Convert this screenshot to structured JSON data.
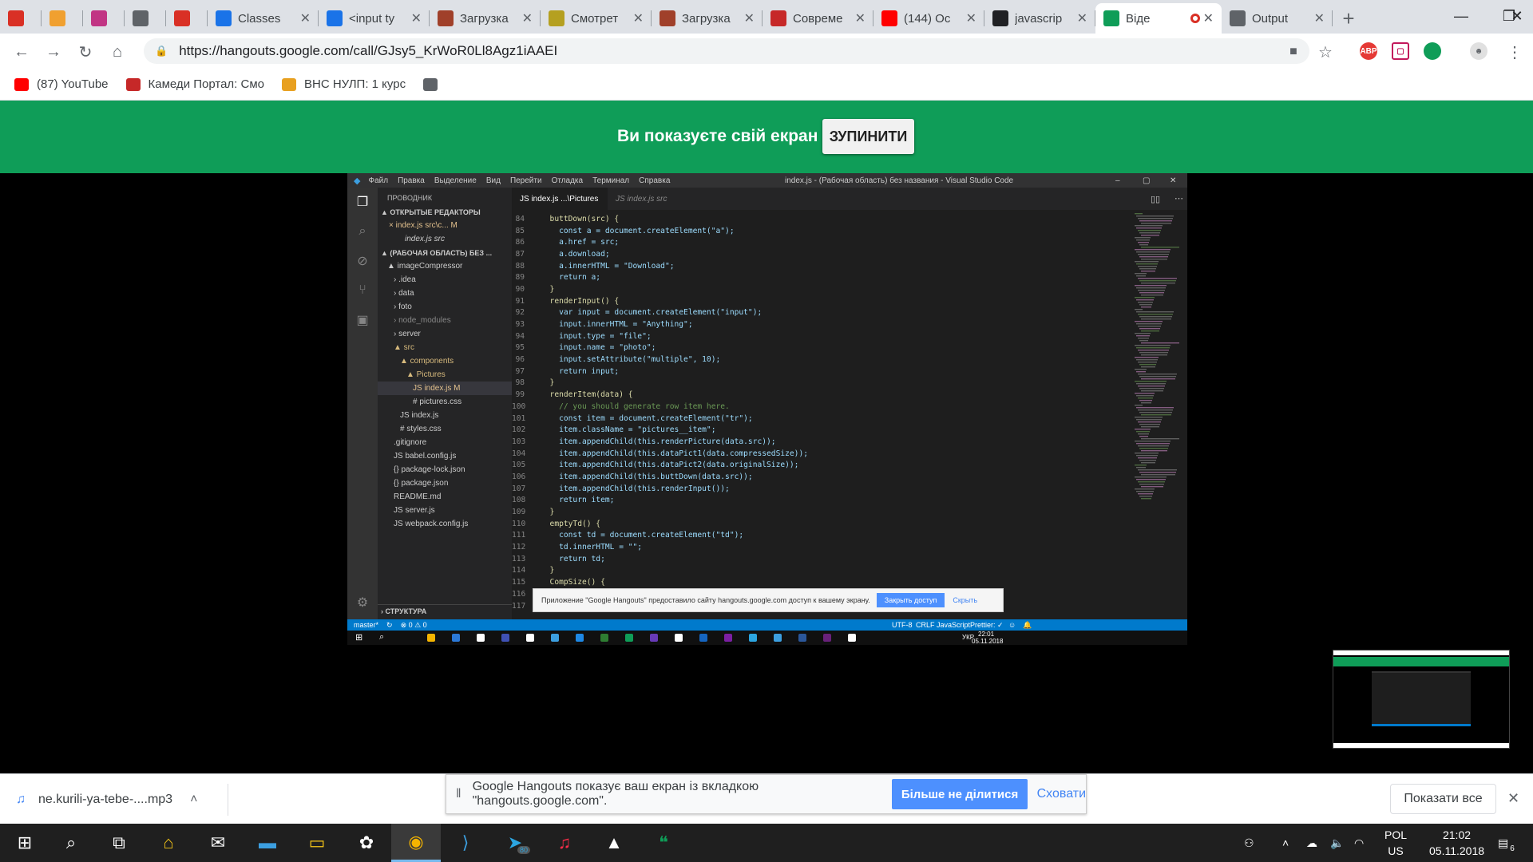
{
  "browser": {
    "tabs": [
      {
        "label": "",
        "icon": "gmail-icon",
        "color": "#d93025"
      },
      {
        "label": "",
        "icon": "moodle-icon",
        "color": "#f0a030"
      },
      {
        "label": "",
        "icon": "instagram-icon",
        "color": "#c13584"
      },
      {
        "label": "",
        "icon": "docs-icon",
        "color": "#5f6368"
      },
      {
        "label": "",
        "icon": "car-icon",
        "color": "#d93025"
      },
      {
        "label": "Classes",
        "icon": "classroom-icon",
        "color": "#1a73e8"
      },
      {
        "label": "<input ty",
        "icon": "classroom-icon",
        "color": "#1a73e8"
      },
      {
        "label": "Загрузка",
        "icon": "square-icon",
        "color": "#a0402a"
      },
      {
        "label": "Смотрет",
        "icon": "hat-icon",
        "color": "#b5a020"
      },
      {
        "label": "Загрузка",
        "icon": "square-icon",
        "color": "#a0402a"
      },
      {
        "label": "Совреме",
        "icon": "figure-icon",
        "color": "#c62828"
      },
      {
        "label": "(144) Oc",
        "icon": "youtube-icon",
        "color": "#ff0000"
      },
      {
        "label": "javascrip",
        "icon": "glasses-icon",
        "color": "#202124"
      },
      {
        "label": "Віде",
        "icon": "hangouts-icon",
        "color": "#0f9d58",
        "active": true
      },
      {
        "label": "Output",
        "icon": "page-icon",
        "color": "#5f6368"
      }
    ],
    "url": "https://hangouts.google.com/call/GJsy5_KrWoR0Ll8Agz1iAAEI",
    "bookmarks": [
      {
        "label": "(87) YouTube",
        "color": "#ff0000"
      },
      {
        "label": "Камеди Портал: Смо",
        "color": "#c62828"
      },
      {
        "label": "ВНС НУЛП: 1 курс",
        "color": "#e8a020"
      },
      {
        "label": "",
        "color": "#5f6368"
      }
    ],
    "ext_abp": "ABP"
  },
  "banner": {
    "text": "Ви показуєте свій екран",
    "stop_label": "ЗУПИНИТИ",
    "color": "#0f9d58"
  },
  "vscode": {
    "menu": [
      "Файл",
      "Правка",
      "Выделение",
      "Вид",
      "Перейти",
      "Отладка",
      "Терминал",
      "Справка"
    ],
    "title": "index.js - (Рабочая область) без названия - Visual Studio Code",
    "explorer_title": "ПРОВОДНИК",
    "open_editors": "▲ ОТКРЫТЫЕ РЕДАКТОРЫ",
    "open_files": [
      "× index.js src\\c...  M",
      "index.js src"
    ],
    "workspace": "▲ (РАБОЧАЯ ОБЛАСТЬ) БЕЗ ...",
    "tree": [
      {
        "label": "▲ imageCompressor",
        "indent": 0,
        "color": "#ccc"
      },
      {
        "label": "› .idea",
        "indent": 1,
        "color": "#ccc"
      },
      {
        "label": "› data",
        "indent": 1,
        "color": "#ccc"
      },
      {
        "label": "› foto",
        "indent": 1,
        "color": "#ccc"
      },
      {
        "label": "› node_modules",
        "indent": 1,
        "color": "#888"
      },
      {
        "label": "› server",
        "indent": 1,
        "color": "#ccc"
      },
      {
        "label": "▲ src",
        "indent": 1,
        "color": "#d7ba7d"
      },
      {
        "label": "▲ components",
        "indent": 2,
        "color": "#d7ba7d"
      },
      {
        "label": "▲ Pictures",
        "indent": 3,
        "color": "#d7ba7d"
      },
      {
        "label": "JS index.js           M",
        "indent": 4,
        "color": "#e2c08d",
        "selected": true
      },
      {
        "label": "# pictures.css",
        "indent": 4,
        "color": "#ccc"
      },
      {
        "label": "JS index.js",
        "indent": 2,
        "color": "#ccc"
      },
      {
        "label": "# styles.css",
        "indent": 2,
        "color": "#ccc"
      },
      {
        "label": ".gitignore",
        "indent": 1,
        "color": "#ccc"
      },
      {
        "label": "JS babel.config.js",
        "indent": 1,
        "color": "#ccc"
      },
      {
        "label": "{} package-lock.json",
        "indent": 1,
        "color": "#ccc"
      },
      {
        "label": "{} package.json",
        "indent": 1,
        "color": "#ccc"
      },
      {
        "label": "README.md",
        "indent": 1,
        "color": "#ccc"
      },
      {
        "label": "JS server.js",
        "indent": 1,
        "color": "#ccc"
      },
      {
        "label": "JS webpack.config.js",
        "indent": 1,
        "color": "#ccc"
      }
    ],
    "outline": "› СТРУКТУРА",
    "editor_tabs": [
      {
        "label": "JS  index.js  ...\\Pictures",
        "active": true
      },
      {
        "label": "JS  index.js  src",
        "active": false
      }
    ],
    "code": [
      {
        "n": "84",
        "t": "  buttDown(src) {"
      },
      {
        "n": "85",
        "t": "    const a = document.createElement(\"a\");"
      },
      {
        "n": "86",
        "t": "    a.href = src;"
      },
      {
        "n": "87",
        "t": "    a.download;"
      },
      {
        "n": "88",
        "t": "    a.innerHTML = \"Download\";"
      },
      {
        "n": "89",
        "t": "    return a;"
      },
      {
        "n": "90",
        "t": "  }"
      },
      {
        "n": "91",
        "t": "  renderInput() {"
      },
      {
        "n": "92",
        "t": "    var input = document.createElement(\"input\");"
      },
      {
        "n": "93",
        "t": "    input.innerHTML = \"Anything\";"
      },
      {
        "n": "94",
        "t": "    input.type = \"file\";"
      },
      {
        "n": "95",
        "t": "    input.name = \"photo\";"
      },
      {
        "n": "96",
        "t": "    input.setAttribute(\"multiple\", 10);"
      },
      {
        "n": "97",
        "t": "    return input;"
      },
      {
        "n": "98",
        "t": "  }"
      },
      {
        "n": "99",
        "t": "  renderItem(data) {"
      },
      {
        "n": "100",
        "t": "    // you should generate row item here."
      },
      {
        "n": "101",
        "t": "    const item = document.createElement(\"tr\");"
      },
      {
        "n": "102",
        "t": "    item.className = \"pictures__item\";"
      },
      {
        "n": "103",
        "t": "    item.appendChild(this.renderPicture(data.src));"
      },
      {
        "n": "104",
        "t": "    item.appendChild(this.dataPict1(data.compressedSize));"
      },
      {
        "n": "105",
        "t": "    item.appendChild(this.dataPict2(data.originalSize));"
      },
      {
        "n": "106",
        "t": "    item.appendChild(this.buttDown(data.src));"
      },
      {
        "n": "107",
        "t": "    item.appendChild(this.renderInput());"
      },
      {
        "n": "108",
        "t": "    return item;"
      },
      {
        "n": "109",
        "t": "  }"
      },
      {
        "n": "110",
        "t": "  emptyTd() {"
      },
      {
        "n": "111",
        "t": "    const td = document.createElement(\"td\");"
      },
      {
        "n": "112",
        "t": "    td.innerHTML = \"\";"
      },
      {
        "n": "113",
        "t": "    return td;"
      },
      {
        "n": "114",
        "t": "  }"
      },
      {
        "n": "115",
        "t": "  CompSize() {"
      },
      {
        "n": "116",
        "t": ""
      },
      {
        "n": "117",
        "t": ""
      }
    ],
    "status": {
      "branch": "master*",
      "problems": "⊗ 0 ⚠ 0",
      "encoding": "UTF-8",
      "eol": "CRLF",
      "language": "JavaScript",
      "prettier": "Prettier: ✓"
    },
    "notice": {
      "text": "Приложение \"Google Hangouts\" предоставило сайту hangouts.google.com доступ к вашему экрану.",
      "close_label": "Закрыть доступ",
      "hide_label": "Скрыть"
    },
    "inner_taskbar": {
      "lang": "УКР",
      "time": "22:01",
      "date": "05.11.2018"
    }
  },
  "downloads": {
    "file": "ne.kurili-ya-tebe-....mp3",
    "share_notice": "Google Hangouts показує ваш екран із вкладкою \"hangouts.google.com\".",
    "stop_share_label": "Більше не ділитися",
    "hide_label": "Сховати",
    "show_all_label": "Показати все"
  },
  "taskbar": {
    "lang1": "POL",
    "lang2": "US",
    "time": "21:02",
    "date": "05.11.2018",
    "notif_count": "6",
    "telegram_badge": "80"
  }
}
